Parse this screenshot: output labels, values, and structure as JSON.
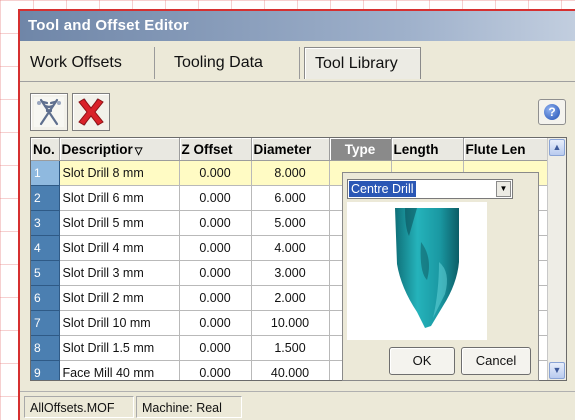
{
  "window": {
    "title": "Tool and Offset Editor"
  },
  "tabs": [
    {
      "label": "Work Offsets"
    },
    {
      "label": "Tooling Data"
    },
    {
      "label": "Tool Library"
    }
  ],
  "toolbar": {
    "buttons": [
      {
        "icon": "drill-tools-icon"
      },
      {
        "icon": "delete-tool-icon"
      }
    ],
    "help_icon_label": "?"
  },
  "table": {
    "columns": [
      "No.",
      "Descriptior",
      "Z Offset",
      "Diameter",
      "Type",
      "Length",
      "Flute Len"
    ],
    "rows": [
      {
        "no": "1",
        "description": "Slot Drill 8 mm",
        "z_offset": "0.000",
        "diameter": "8.000"
      },
      {
        "no": "2",
        "description": "Slot Drill 6 mm",
        "z_offset": "0.000",
        "diameter": "6.000"
      },
      {
        "no": "3",
        "description": "Slot Drill 5 mm",
        "z_offset": "0.000",
        "diameter": "5.000"
      },
      {
        "no": "4",
        "description": "Slot Drill 4 mm",
        "z_offset": "0.000",
        "diameter": "4.000"
      },
      {
        "no": "5",
        "description": "Slot Drill 3 mm",
        "z_offset": "0.000",
        "diameter": "3.000"
      },
      {
        "no": "6",
        "description": "Slot Drill 2 mm",
        "z_offset": "0.000",
        "diameter": "2.000"
      },
      {
        "no": "7",
        "description": "Slot Drill 10 mm",
        "z_offset": "0.000",
        "diameter": "10.000"
      },
      {
        "no": "8",
        "description": "Slot Drill 1.5 mm",
        "z_offset": "0.000",
        "diameter": "1.500"
      },
      {
        "no": "9",
        "description": "Face Mill 40 mm",
        "z_offset": "0.000",
        "diameter": "40.000"
      }
    ],
    "selected_row": 0
  },
  "type_popup": {
    "selected_type": "Centre Drill",
    "ok_label": "OK",
    "cancel_label": "Cancel"
  },
  "statusbar": {
    "file": "AllOffsets.MOF",
    "machine": "Machine: Real"
  },
  "colors": {
    "titlebar": "#6f86a8",
    "row_number_bg": "#4b7fb1",
    "selected_row_bg": "#fffbc4",
    "tool_preview": "#1fa0a8"
  }
}
